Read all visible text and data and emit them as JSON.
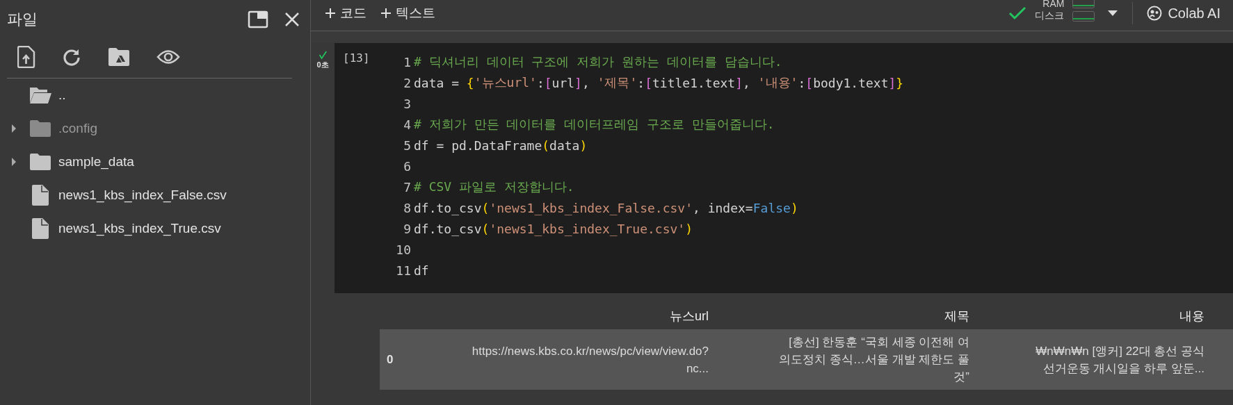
{
  "sidebar": {
    "title": "파일",
    "items": [
      {
        "kind": "parent",
        "name": "..",
        "dimmed": false
      },
      {
        "kind": "folder",
        "name": ".config",
        "expanded": false,
        "dimmed": true
      },
      {
        "kind": "folder",
        "name": "sample_data",
        "expanded": false,
        "dimmed": false
      },
      {
        "kind": "file",
        "name": "news1_kbs_index_False.csv",
        "dimmed": false
      },
      {
        "kind": "file",
        "name": "news1_kbs_index_True.csv",
        "dimmed": false
      }
    ]
  },
  "toolbar": {
    "buttons": [
      "코드",
      "텍스트"
    ],
    "resources": [
      "RAM",
      "디스크"
    ],
    "ai_button": "Colab AI"
  },
  "cell": {
    "execution_count": "[13]",
    "duration": "0초",
    "succeeded": true,
    "lines": [
      {
        "number": "1",
        "tokens": [
          {
            "kind": "comment",
            "text": "# 딕셔너리 데이터 구조에 저희가 원하는 데이터를 담습니다."
          }
        ]
      },
      {
        "number": "2",
        "tokens": [
          {
            "kind": "plain",
            "text": "data = "
          },
          {
            "kind": "brace",
            "text": "{"
          },
          {
            "kind": "string",
            "text": "'뉴스url'"
          },
          {
            "kind": "plain",
            "text": ":"
          },
          {
            "kind": "bracket",
            "text": "["
          },
          {
            "kind": "plain",
            "text": "url"
          },
          {
            "kind": "bracket",
            "text": "]"
          },
          {
            "kind": "plain",
            "text": ", "
          },
          {
            "kind": "string",
            "text": "'제목'"
          },
          {
            "kind": "plain",
            "text": ":"
          },
          {
            "kind": "bracket",
            "text": "["
          },
          {
            "kind": "plain",
            "text": "title1.text"
          },
          {
            "kind": "bracket",
            "text": "]"
          },
          {
            "kind": "plain",
            "text": ", "
          },
          {
            "kind": "string",
            "text": "'내용'"
          },
          {
            "kind": "plain",
            "text": ":"
          },
          {
            "kind": "bracket",
            "text": "["
          },
          {
            "kind": "plain",
            "text": "body1.text"
          },
          {
            "kind": "bracket",
            "text": "]"
          },
          {
            "kind": "brace",
            "text": "}"
          }
        ]
      },
      {
        "number": "3"
      },
      {
        "number": "4",
        "tokens": [
          {
            "kind": "comment",
            "text": "# 저희가 만든 데이터를 데이터프레임 구조로 만들어줍니다."
          }
        ]
      },
      {
        "number": "5",
        "tokens": [
          {
            "kind": "plain",
            "text": "df = pd.DataFrame"
          },
          {
            "kind": "brace",
            "text": "("
          },
          {
            "kind": "plain",
            "text": "data"
          },
          {
            "kind": "brace",
            "text": ")"
          }
        ]
      },
      {
        "number": "6"
      },
      {
        "number": "7",
        "tokens": [
          {
            "kind": "comment",
            "text": "# CSV 파일로 저장합니다."
          }
        ]
      },
      {
        "number": "8",
        "tokens": [
          {
            "kind": "plain",
            "text": "df.to_csv"
          },
          {
            "kind": "brace",
            "text": "("
          },
          {
            "kind": "string",
            "text": "'news1_kbs_index_False.csv'"
          },
          {
            "kind": "plain",
            "text": ", index="
          },
          {
            "kind": "keyword",
            "text": "False"
          },
          {
            "kind": "brace",
            "text": ")"
          }
        ]
      },
      {
        "number": "9",
        "tokens": [
          {
            "kind": "plain",
            "text": "df.to_csv"
          },
          {
            "kind": "brace",
            "text": "("
          },
          {
            "kind": "string",
            "text": "'news1_kbs_index_True.csv'"
          },
          {
            "kind": "brace",
            "text": ")"
          }
        ]
      },
      {
        "number": "10"
      },
      {
        "number": "11",
        "tokens": [
          {
            "kind": "plain",
            "text": "df"
          }
        ]
      }
    ]
  },
  "output": {
    "table": {
      "columns": [
        "뉴스url",
        "제목",
        "내용"
      ],
      "rows": [
        {
          "index": "0",
          "cells": [
            "https://news.kbs.co.kr/news/pc/view/view.do?\nnc...",
            "[총선] 한동훈 “국회 세종 이전해 여\n의도정치 종식…서울 개발 제한도 풀\n것”",
            "₩n₩n₩n [앵커] 22대 총선 공식\n선거운동 개시일을 하루 앞둔..."
          ]
        }
      ]
    }
  }
}
